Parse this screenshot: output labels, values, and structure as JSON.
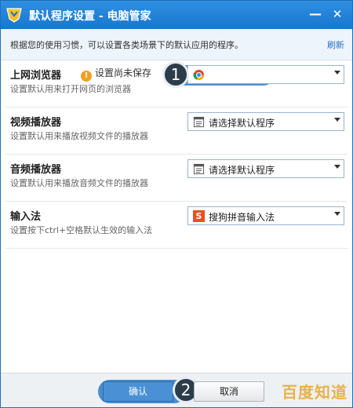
{
  "window": {
    "title": "默认程序设置 - 电脑管家",
    "minimize_glyph": "—",
    "close_glyph": "✕"
  },
  "info": {
    "text": "根据您的使用习惯，可以设置各类场景下的默认应用的程序。",
    "refresh_label": "刷新"
  },
  "rows": [
    {
      "title": "上网浏览器",
      "desc": "设置默认用来打开网页的浏览器",
      "warning": "设置尚未保存",
      "warning_icon": "!",
      "select_value": "谷歌浏览器",
      "icon": "chrome-icon"
    },
    {
      "title": "视频播放器",
      "desc": "设置默认用来播放视频文件的播放器",
      "select_value": "请选择默认程序",
      "icon": "program-icon"
    },
    {
      "title": "音频播放器",
      "desc": "设置默认用来播放音频文件的播放器",
      "select_value": "请选择默认程序",
      "icon": "program-icon"
    },
    {
      "title": "输入法",
      "desc": "设置按下ctrl+空格默认生效的输入法",
      "select_value": "搜狗拼音输入法",
      "icon": "sogou-icon",
      "icon_text": "S"
    }
  ],
  "steps": {
    "first": "1",
    "second": "2"
  },
  "footer": {
    "ok_label": "确认",
    "cancel_label": "取消",
    "watermark": "百度知道"
  },
  "colors": {
    "titlebar": "#1f7fd6",
    "highlight": "#2c7bc6",
    "watermark": "#e8b24a"
  }
}
